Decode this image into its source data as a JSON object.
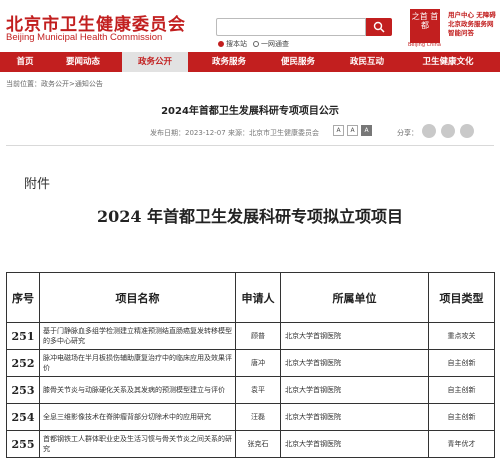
{
  "header": {
    "site_title": "北京市卫生健康委员会",
    "site_subtitle": "Beijing Municipal Health Commission",
    "search_placeholder": "",
    "scope_options": [
      {
        "label": "搜本站",
        "selected": true
      },
      {
        "label": "一网通查",
        "selected": false
      }
    ],
    "emblem_text": "之首 首都",
    "emblem_caption": "Beijing China",
    "side_links": [
      "用户中心",
      "无障碍",
      "北京政务服务网",
      "智能问答"
    ],
    "icons": {
      "search": "search-icon"
    },
    "colors": {
      "brand": "#c21f1f"
    }
  },
  "nav": {
    "items": [
      {
        "label": "首页",
        "active": false
      },
      {
        "label": "要闻动态",
        "active": false
      },
      {
        "label": "政务公开",
        "active": true
      },
      {
        "label": "政务服务",
        "active": false
      },
      {
        "label": "便民服务",
        "active": false
      },
      {
        "label": "政民互动",
        "active": false
      },
      {
        "label": "卫生健康文化",
        "active": false
      }
    ]
  },
  "breadcrumb": {
    "prefix": "当前位置：",
    "path": "政务公开>通知公告"
  },
  "article": {
    "title": "2024年首都卫生发展科研专项项目公示",
    "publish_label": "发布日期：",
    "publish_date": "2023-12-07",
    "source_label": "来源：",
    "source": "北京市卫生健康委员会",
    "font_buttons": [
      "A",
      "A",
      "A"
    ],
    "share_label": "分享：",
    "share_icons": [
      "wechat-icon",
      "weibo-icon",
      "qzone-icon"
    ]
  },
  "document": {
    "attachment_label": "附件",
    "title": "2024 年首都卫生发展科研专项拟立项项目",
    "table": {
      "headers": [
        "序号",
        "项目名称",
        "申请人",
        "所属单位",
        "项目类型"
      ],
      "rows": [
        {
          "no": "251",
          "name": "基于门静脉血多组学检测建立精准预测结直肠癌复发转移模型的多中心研究",
          "applicant": "顾普",
          "unit": "北京大学首钢医院",
          "type": "重点攻关"
        },
        {
          "no": "252",
          "name": "脉冲电磁场在半月板损伤辅助康复治疗中的临床应用及效果评价",
          "applicant": "唐冲",
          "unit": "北京大学首钢医院",
          "type": "自主创新"
        },
        {
          "no": "253",
          "name": "膝骨关节炎与动脉硬化关系及其发病的预测模型建立与评价",
          "applicant": "袁平",
          "unit": "北京大学首钢医院",
          "type": "自主创新"
        },
        {
          "no": "254",
          "name": "全息三维影像技术在脊肿瘤背部分切除术中的应用研究",
          "applicant": "汪磊",
          "unit": "北京大学首钢医院",
          "type": "自主创新"
        },
        {
          "no": "255",
          "name": "首都钢铁工人群体职业史及生活习惯与骨关节炎之间关系的研究",
          "applicant": "张克石",
          "unit": "北京大学首钢医院",
          "type": "青年优才"
        }
      ]
    }
  }
}
